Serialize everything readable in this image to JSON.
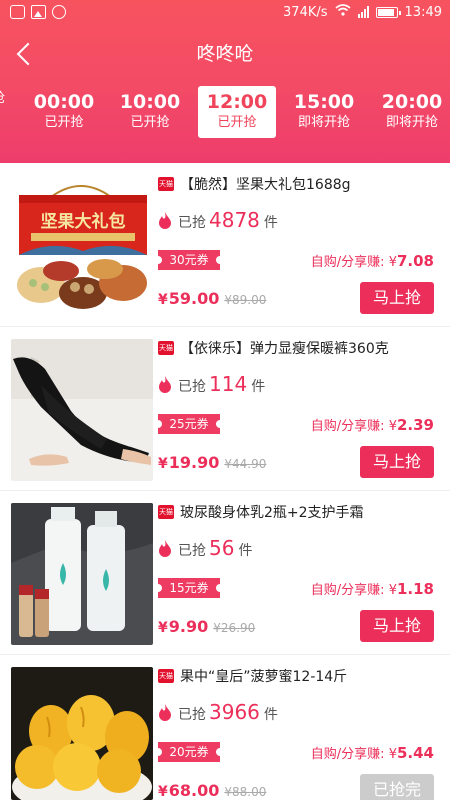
{
  "status_bar": {
    "speed": "374K/s",
    "time": "13:49"
  },
  "nav": {
    "title": "咚咚呛"
  },
  "tabs": [
    {
      "time": "",
      "status": "抢"
    },
    {
      "time": "00:00",
      "status": "已开抢"
    },
    {
      "time": "10:00",
      "status": "已开抢"
    },
    {
      "time": "12:00",
      "status": "已开抢",
      "active": true
    },
    {
      "time": "15:00",
      "status": "即将开抢"
    },
    {
      "time": "20:00",
      "status": "即将开抢"
    }
  ],
  "colors": {
    "brand": "#ec2f5a",
    "header_top": "#f7535f",
    "header_bottom": "#ee3d6c",
    "soldout": "#cccccc"
  },
  "badge_text": "天猫",
  "sold_prefix": "已抢",
  "sold_unit": "件",
  "earn_label": "自购/分享赚: ",
  "currency": "¥",
  "products": [
    {
      "title": "【脆然】坚果大礼包1688g",
      "sold": "4878",
      "coupon": "30元券",
      "earn": "7.08",
      "price": "59.00",
      "old_price": "¥89.00",
      "button": "马上抢",
      "image": "nut-gift-box",
      "box_text": "坚果大礼包"
    },
    {
      "title": "【依徕乐】弹力显瘦保暖裤360克",
      "sold": "114",
      "coupon": "25元券",
      "earn": "2.39",
      "price": "19.90",
      "old_price": "¥44.90",
      "button": "马上抢",
      "image": "black-leggings"
    },
    {
      "title": "玻尿酸身体乳2瓶+2支护手霜",
      "sold": "56",
      "coupon": "15元券",
      "earn": "1.18",
      "price": "9.90",
      "old_price": "¥26.90",
      "button": "马上抢",
      "image": "body-lotion-bottles"
    },
    {
      "title": "果中“皇后”菠萝蜜12-14斤",
      "sold": "3966",
      "coupon": "20元券",
      "earn": "5.44",
      "price": "68.00",
      "old_price": "¥88.00",
      "button": "已抢完",
      "image": "jackfruit"
    }
  ]
}
